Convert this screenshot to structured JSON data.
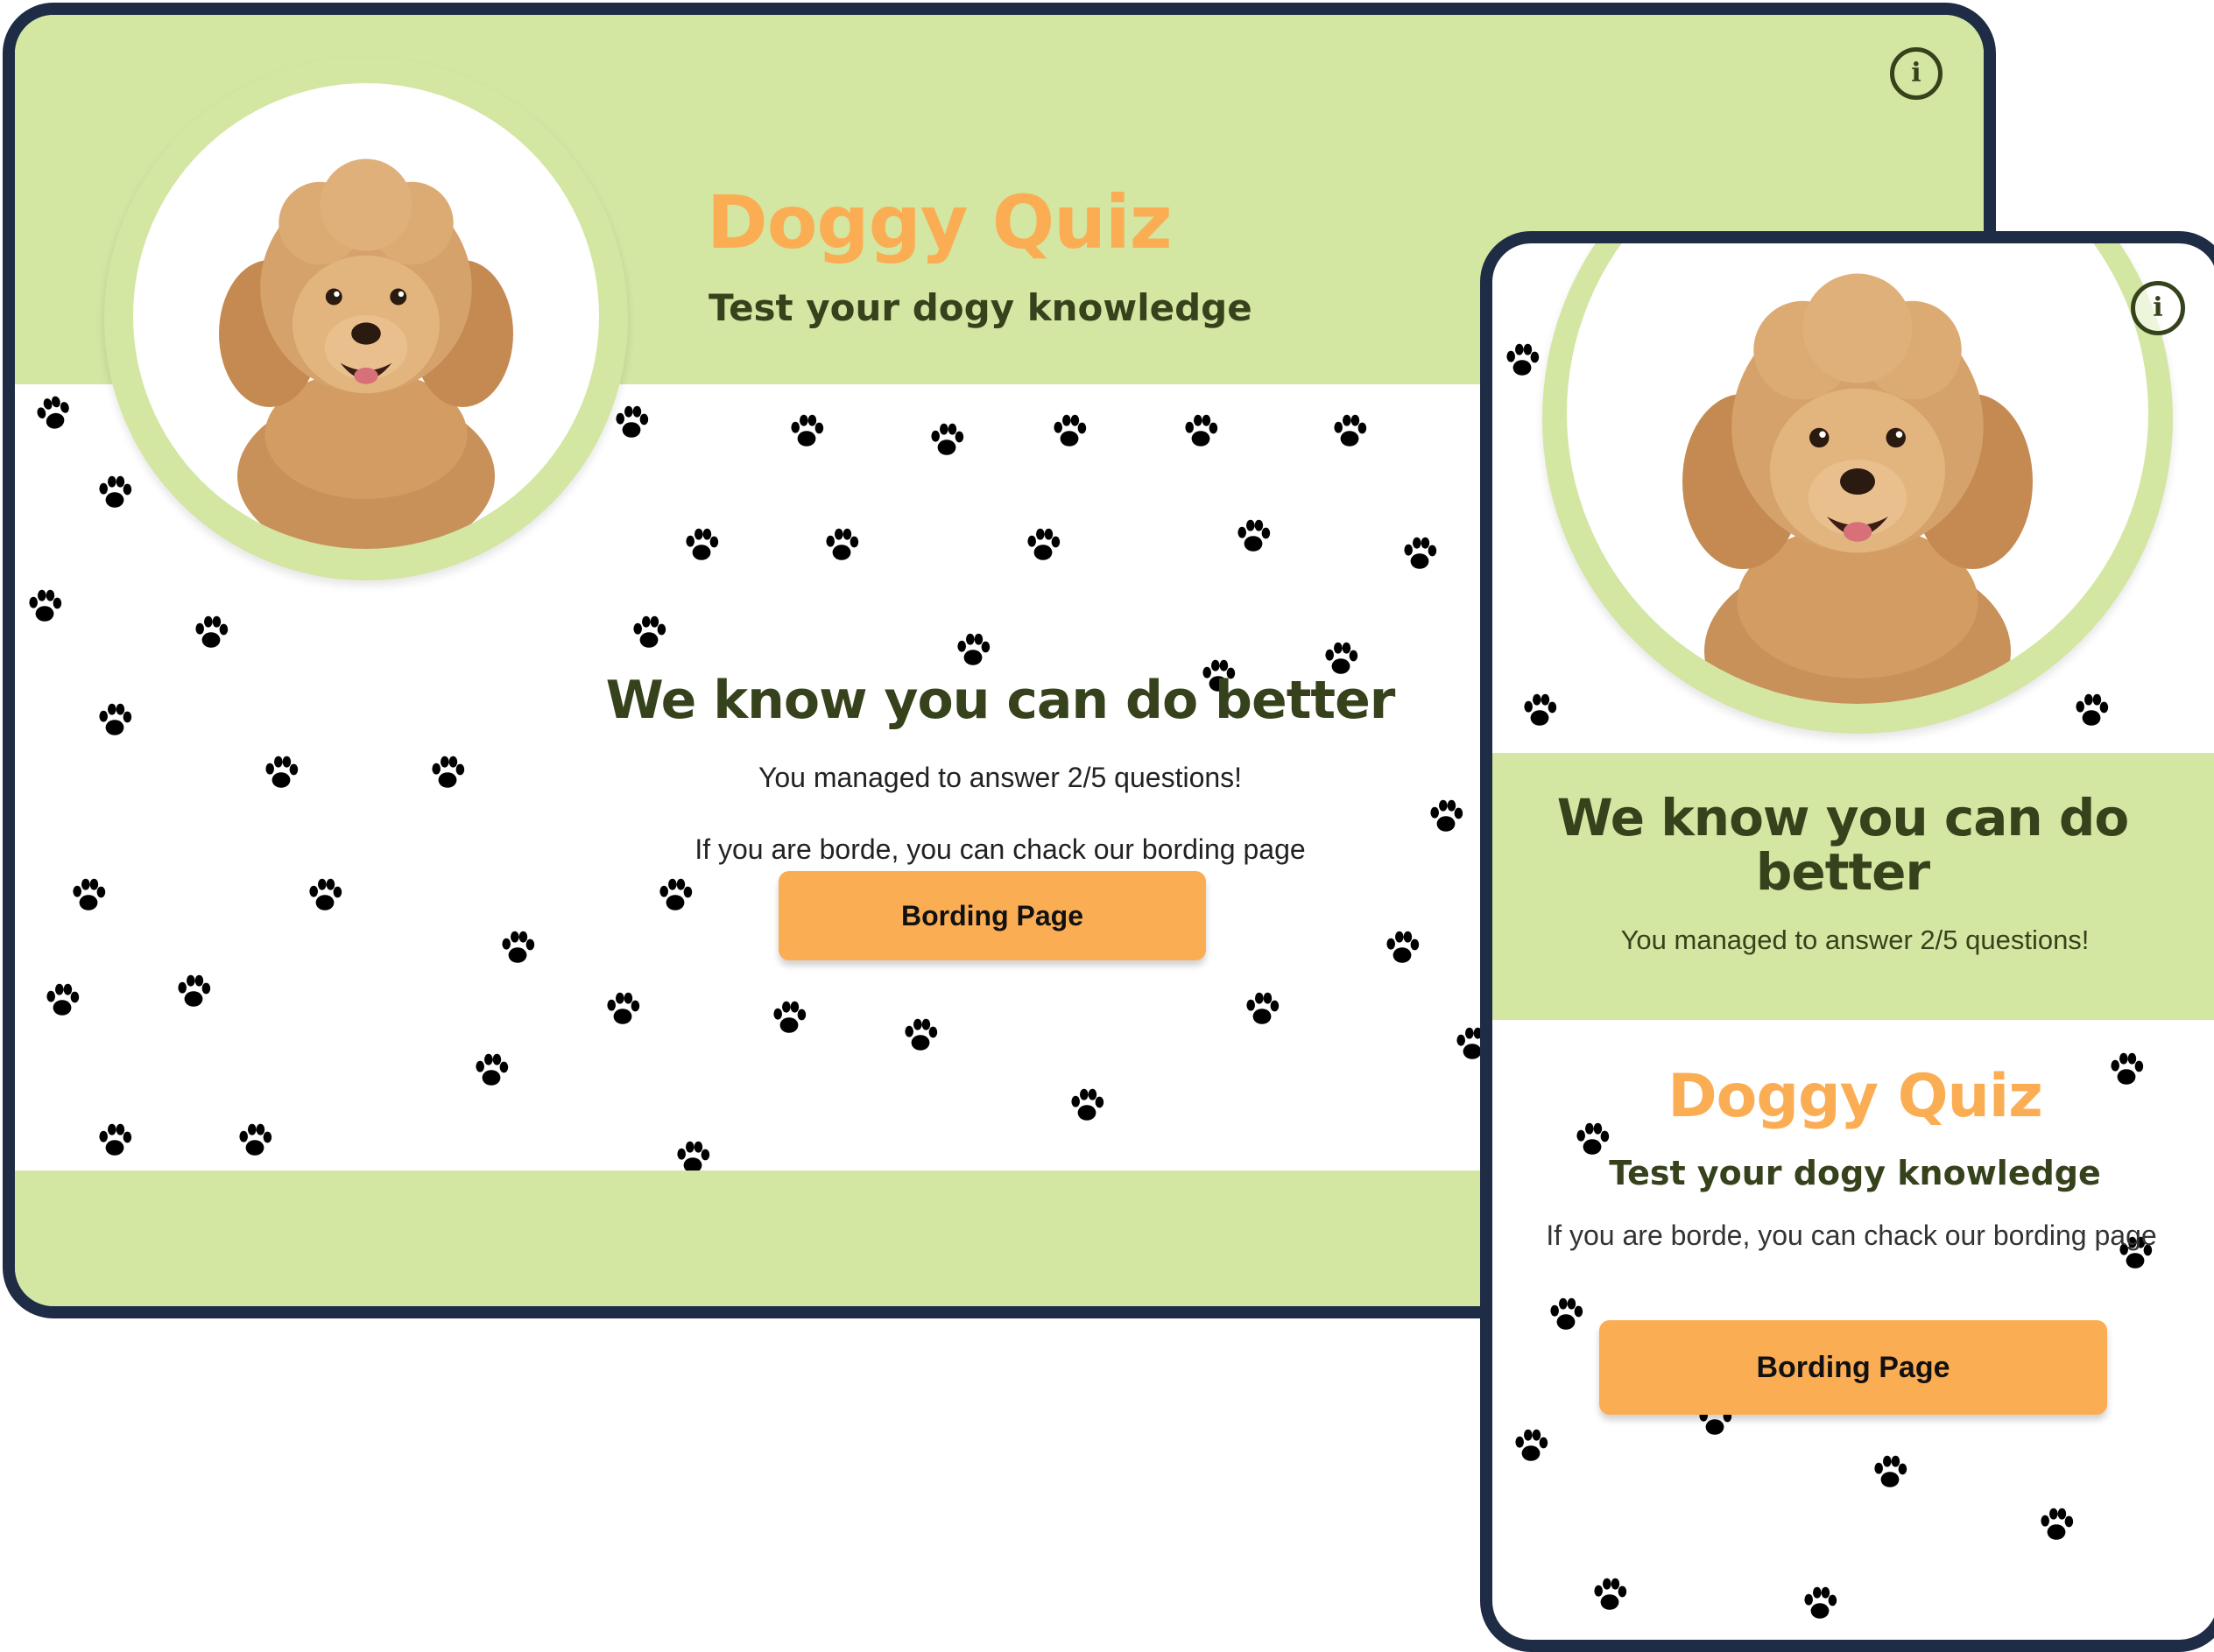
{
  "desktop": {
    "title": "Doggy Quiz",
    "subtitle": "Test your dogy knowledge",
    "result_heading": "We know you can do better",
    "score_text": "You managed to answer 2/5 questions!",
    "bored_text": "If you are borde, you can chack our bording page",
    "button_label": "Bording Page",
    "info_label": "i"
  },
  "mobile": {
    "title": "Doggy Quiz",
    "subtitle": "Test your dogy knowledge",
    "result_heading": "We know you can do better",
    "score_text": "You managed to answer 2/5 questions!",
    "bored_text": "If you are borde, you can chack our bording page",
    "button_label": "Bording Page",
    "info_label": "i"
  },
  "icons": {
    "info": "info-icon",
    "paw": "paw-print-icon",
    "photo": "poodle-photo"
  },
  "colors": {
    "header_green": "#d3e6a2",
    "accent_orange": "#fbad54",
    "text_dark_green": "#36421c",
    "frame_navy": "#1f2c46"
  }
}
